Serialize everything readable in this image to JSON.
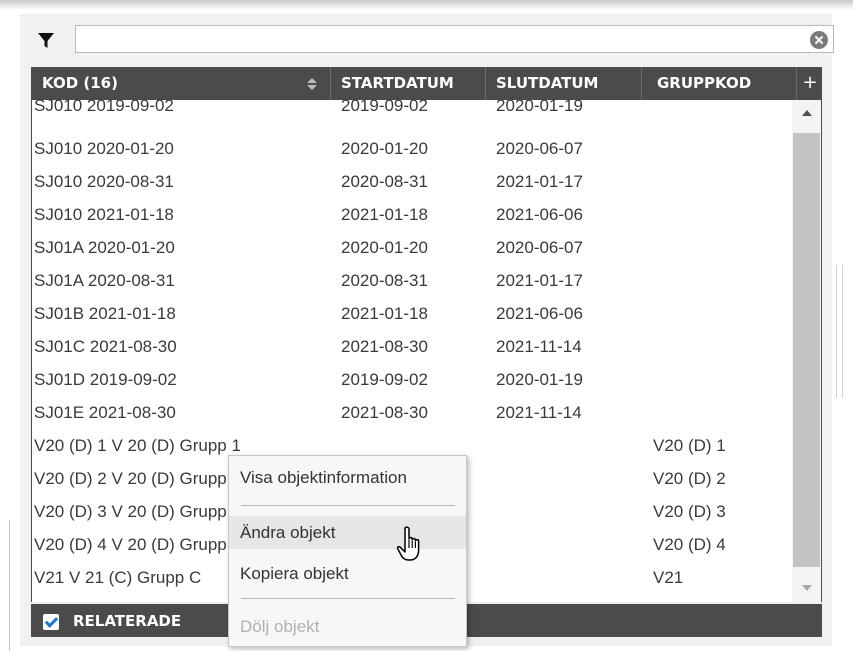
{
  "filter": {
    "icon": "filter-icon",
    "value": "",
    "clear_icon": "clear-circle-icon"
  },
  "grid": {
    "columns": [
      {
        "key": "kod",
        "label": "KOD (16)"
      },
      {
        "key": "start",
        "label": "STARTDATUM"
      },
      {
        "key": "slut",
        "label": "SLUTDATUM"
      },
      {
        "key": "grupp",
        "label": "GRUPPKOD"
      }
    ],
    "add_column_label": "+",
    "sort_icon": "sort-updown-icon",
    "rows": [
      {
        "kod": "SJ010 2019-09-02",
        "start": "2019-09-02",
        "slut": "2020-01-19",
        "grupp": ""
      },
      {
        "kod": "SJ010 2020-01-20",
        "start": "2020-01-20",
        "slut": "2020-06-07",
        "grupp": ""
      },
      {
        "kod": "SJ010 2020-08-31",
        "start": "2020-08-31",
        "slut": "2021-01-17",
        "grupp": ""
      },
      {
        "kod": "SJ010 2021-01-18",
        "start": "2021-01-18",
        "slut": "2021-06-06",
        "grupp": ""
      },
      {
        "kod": "SJ01A 2020-01-20",
        "start": "2020-01-20",
        "slut": "2020-06-07",
        "grupp": ""
      },
      {
        "kod": "SJ01A 2020-08-31",
        "start": "2020-08-31",
        "slut": "2021-01-17",
        "grupp": ""
      },
      {
        "kod": "SJ01B 2021-01-18",
        "start": "2021-01-18",
        "slut": "2021-06-06",
        "grupp": ""
      },
      {
        "kod": "SJ01C 2021-08-30",
        "start": "2021-08-30",
        "slut": "2021-11-14",
        "grupp": ""
      },
      {
        "kod": "SJ01D 2019-09-02",
        "start": "2019-09-02",
        "slut": "2020-01-19",
        "grupp": ""
      },
      {
        "kod": "SJ01E 2021-08-30",
        "start": "2021-08-30",
        "slut": "2021-11-14",
        "grupp": ""
      },
      {
        "kod": "V20 (D) 1 V 20 (D) Grupp 1",
        "start": "",
        "slut": "",
        "grupp": "V20 (D) 1"
      },
      {
        "kod": "V20 (D) 2 V 20 (D) Grupp 2",
        "start": "",
        "slut": "",
        "grupp": "V20 (D) 2"
      },
      {
        "kod": "V20 (D) 3 V 20 (D) Grupp 3",
        "start": "",
        "slut": "",
        "grupp": "V20 (D) 3"
      },
      {
        "kod": "V20 (D) 4 V 20 (D) Grupp 4",
        "start": "",
        "slut": "",
        "grupp": "V20 (D) 4"
      },
      {
        "kod": "V21 V 21 (C) Grupp C",
        "start": "",
        "slut": "",
        "grupp": "V21"
      }
    ]
  },
  "footer": {
    "checkbox_checked": true,
    "label": "RELATERADE"
  },
  "context_menu": {
    "items": [
      {
        "label": "Visa objektinformation",
        "state": "normal"
      },
      {
        "label": "Ändra objekt",
        "state": "hover"
      },
      {
        "label": "Kopiera objekt",
        "state": "normal"
      },
      {
        "label": "Dölj objekt",
        "state": "disabled"
      }
    ]
  },
  "cursor": "hand-pointer-icon"
}
